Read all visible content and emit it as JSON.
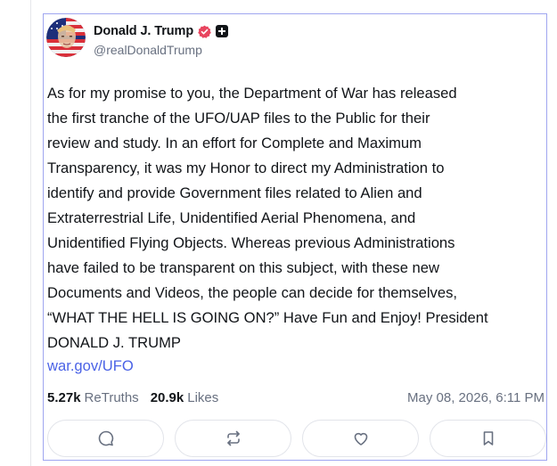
{
  "author": {
    "display_name": "Donald J. Trump",
    "handle": "@realDonaldTrump",
    "avatar_icon": "avatar-flag-portrait",
    "verified_icon": "verified-badge-icon",
    "verified_color": "#e8455f",
    "plus_icon": "plus-badge-icon"
  },
  "post": {
    "text": "As for my promise to you, the Department of War has released\nthe first tranche of the UFO/UAP files to the Public for their\nreview and study. In an effort for Complete and Maximum\nTransparency, it was my Honor to direct my Administration to\nidentify and provide Government files related to Alien and\nExtraterrestrial Life, Unidentified Aerial Phenomena, and\nUnidentified Flying Objects. Whereas previous Administrations\nhave failed to be transparent on this subject, with these new\nDocuments and Videos, the people can decide for themselves,\n“WHAT THE HELL IS GOING ON?” Have Fun and Enjoy! President\nDONALD J. TRUMP",
    "link_text": "war.gov/UFO",
    "link_color": "#4a62e6"
  },
  "stats": {
    "retruths_count": "5.27k",
    "retruths_label": "ReTruths",
    "likes_count": "20.9k",
    "likes_label": "Likes",
    "timestamp": "May 08, 2026, 6:11 PM"
  },
  "actions": [
    {
      "icon": "reply-icon"
    },
    {
      "icon": "retruth-icon"
    },
    {
      "icon": "like-heart-icon"
    },
    {
      "icon": "bookmark-icon"
    }
  ],
  "colors": {
    "card_border": "#9fa6f0",
    "secondary_text": "#687080",
    "primary_text": "#111418"
  }
}
